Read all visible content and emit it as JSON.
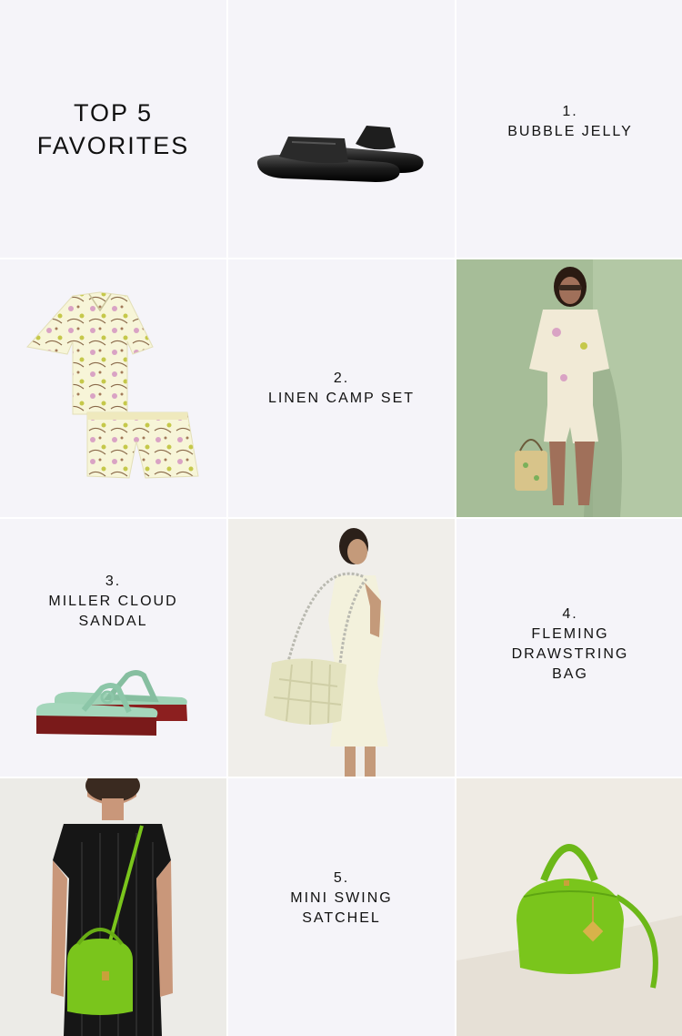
{
  "header": {
    "title": "TOP 5\nFAVORITES"
  },
  "items": [
    {
      "number": "1.",
      "name": "BUBBLE JELLY"
    },
    {
      "number": "2.",
      "name": "LINEN CAMP SET"
    },
    {
      "number": "3.",
      "name": "MILLER CLOUD\nSANDAL"
    },
    {
      "number": "4.",
      "name": "FLEMING\nDRAWSTRING\nBAG"
    },
    {
      "number": "5.",
      "name": "MINI SWING\nSATCHEL"
    }
  ],
  "colors": {
    "panel": "#f5f4f9",
    "text": "#111111",
    "jelly_black": "#1a1a1a",
    "sage_bg": "#a9c09a",
    "mint_sandal": "#9ed2b5",
    "red_sole": "#8c1f1f",
    "bag_cream": "#e8e8c6",
    "lime_green": "#7ac51c"
  }
}
